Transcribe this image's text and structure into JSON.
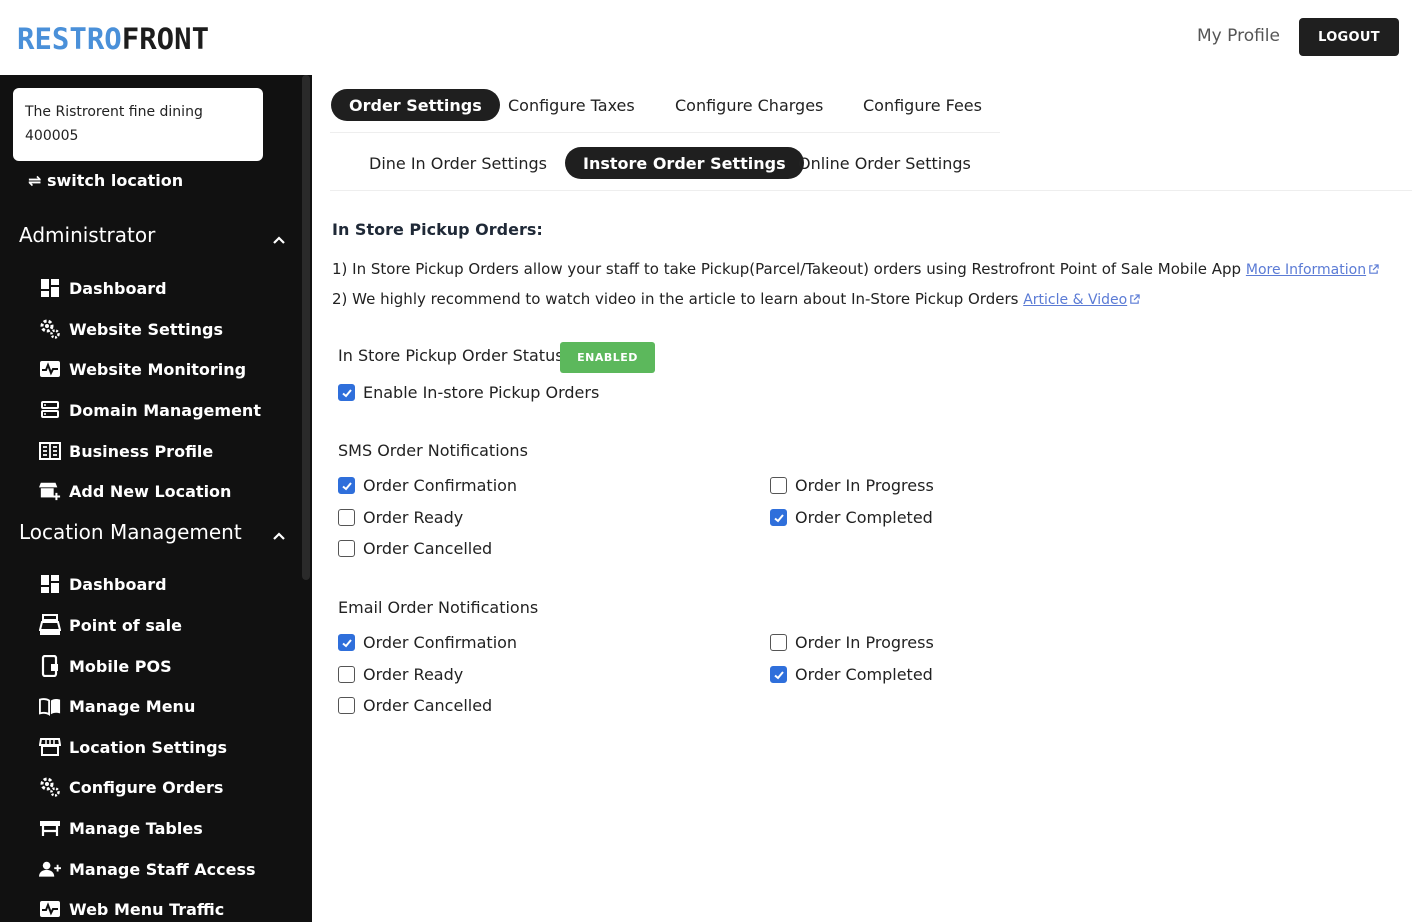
{
  "header": {
    "logo_part1": "RESTRO",
    "logo_part2": "FRONT",
    "my_profile": "My Profile",
    "logout": "LOGOUT"
  },
  "sidebar": {
    "location_name": "The Ristrorent fine dining",
    "location_code": "400005",
    "switch_location": "⇌ switch location",
    "admin_title": "Administrator",
    "admin_items": [
      {
        "label": "Dashboard",
        "icon": "dashboard-icon"
      },
      {
        "label": "Website Settings",
        "icon": "gears-icon"
      },
      {
        "label": "Website Monitoring",
        "icon": "pulse-icon"
      },
      {
        "label": "Domain Management",
        "icon": "server-icon"
      },
      {
        "label": "Business Profile",
        "icon": "building-icon"
      },
      {
        "label": "Add New Location",
        "icon": "store-add-icon"
      }
    ],
    "loc_title": "Location Management",
    "loc_items": [
      {
        "label": "Dashboard",
        "icon": "dashboard-icon"
      },
      {
        "label": "Point of sale",
        "icon": "cash-register-icon"
      },
      {
        "label": "Mobile POS",
        "icon": "mobile-icon"
      },
      {
        "label": "Manage Menu",
        "icon": "book-icon"
      },
      {
        "label": "Location Settings",
        "icon": "store-icon"
      },
      {
        "label": "Configure Orders",
        "icon": "gears-icon"
      },
      {
        "label": "Manage Tables",
        "icon": "table-icon"
      },
      {
        "label": "Manage Staff Access",
        "icon": "user-add-icon"
      },
      {
        "label": "Web Menu Traffic",
        "icon": "pulse-icon"
      }
    ]
  },
  "tabs_primary": [
    {
      "label": "Order Settings",
      "active": true
    },
    {
      "label": "Configure Taxes",
      "active": false
    },
    {
      "label": "Configure Charges",
      "active": false
    },
    {
      "label": "Configure Fees",
      "active": false
    }
  ],
  "tabs_secondary": [
    {
      "label": "Dine In Order Settings",
      "active": false
    },
    {
      "label": "Instore Order Settings",
      "active": true
    },
    {
      "label": "Online Order Settings",
      "active": false
    }
  ],
  "content": {
    "heading": "In Store Pickup Orders:",
    "info1": "1) In Store Pickup Orders allow your staff to take Pickup(Parcel/Takeout) orders using Restrofront Point of Sale Mobile App",
    "info1_link": "More Information",
    "info2": "2) We highly recommend to watch video in the article to learn about In-Store Pickup Orders",
    "info2_link": "Article & Video",
    "status_label": "In Store Pickup Order Status:",
    "status_badge": "ENABLED",
    "enable_label": "Enable In-store Pickup Orders",
    "enable_checked": true,
    "sms_title": "SMS Order Notifications",
    "email_title": "Email Order Notifications",
    "sms": [
      {
        "label": "Order Confirmation",
        "checked": true
      },
      {
        "label": "Order In Progress",
        "checked": false
      },
      {
        "label": "Order Ready",
        "checked": false
      },
      {
        "label": "Order Completed",
        "checked": true
      },
      {
        "label": "Order Cancelled",
        "checked": false
      }
    ],
    "email": [
      {
        "label": "Order Confirmation",
        "checked": true
      },
      {
        "label": "Order In Progress",
        "checked": false
      },
      {
        "label": "Order Ready",
        "checked": false
      },
      {
        "label": "Order Completed",
        "checked": true
      },
      {
        "label": "Order Cancelled",
        "checked": false
      }
    ]
  },
  "colors": {
    "accent_blue": "#4a90d9",
    "checkbox_blue": "#2f6fdb",
    "badge_green": "#5cb85c",
    "sidebar_bg": "#111111"
  }
}
